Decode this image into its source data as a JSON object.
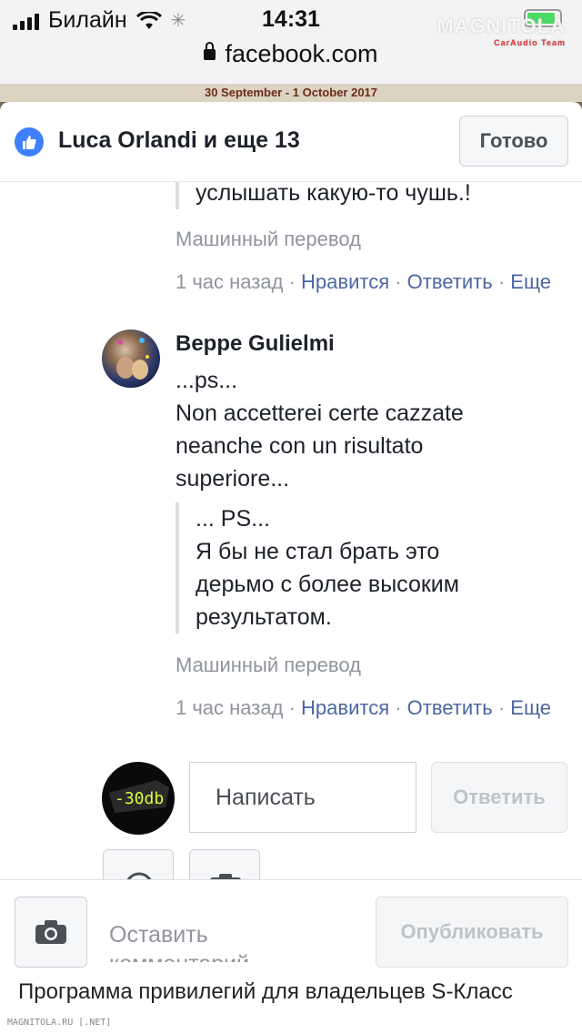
{
  "status_bar": {
    "carrier": "Билайн",
    "time": "14:31",
    "watermark": "MAGNITOLA",
    "watermark_sub": "CarAudio Team"
  },
  "url_bar": {
    "domain": "facebook.com"
  },
  "background_page": {
    "banner": "30 September - 1 October 2017",
    "bottom_text": "Программа привилегий для владельцев S-Класс",
    "footer_tag": "MAGNITOLA.RU [.NET]"
  },
  "modal": {
    "title": "Luca Orlandi и еще 13",
    "done_label": "Готово"
  },
  "comments": [
    {
      "translation_tail": "услышать какую-то чушь.!",
      "machine_translation_label": "Машинный перевод",
      "time": "1 час назад",
      "like": "Нравится",
      "reply": "Ответить",
      "more": "Еще"
    },
    {
      "author": "Beppe Gulielmi",
      "text_lines": [
        "...ps...",
        "Non accetterei certe cazzate",
        "neanche con un risultato",
        "superiore..."
      ],
      "translation_lines": [
        "... PS...",
        "Я бы не стал брать это",
        "дерьмо с более высоким",
        "результатом."
      ],
      "machine_translation_label": "Машинный перевод",
      "time": "1 час назад",
      "like": "Нравится",
      "reply": "Ответить",
      "more": "Еще"
    }
  ],
  "reply_box": {
    "avatar_text": "-30db",
    "placeholder": "Написать",
    "reply_button": "Ответить"
  },
  "composer": {
    "placeholder_line1": "Оставить",
    "placeholder_line2": "комментарий",
    "publish_button": "Опубликовать"
  },
  "colors": {
    "accent": "#4080ff",
    "link": "#4b67a1",
    "muted": "#90949c"
  }
}
